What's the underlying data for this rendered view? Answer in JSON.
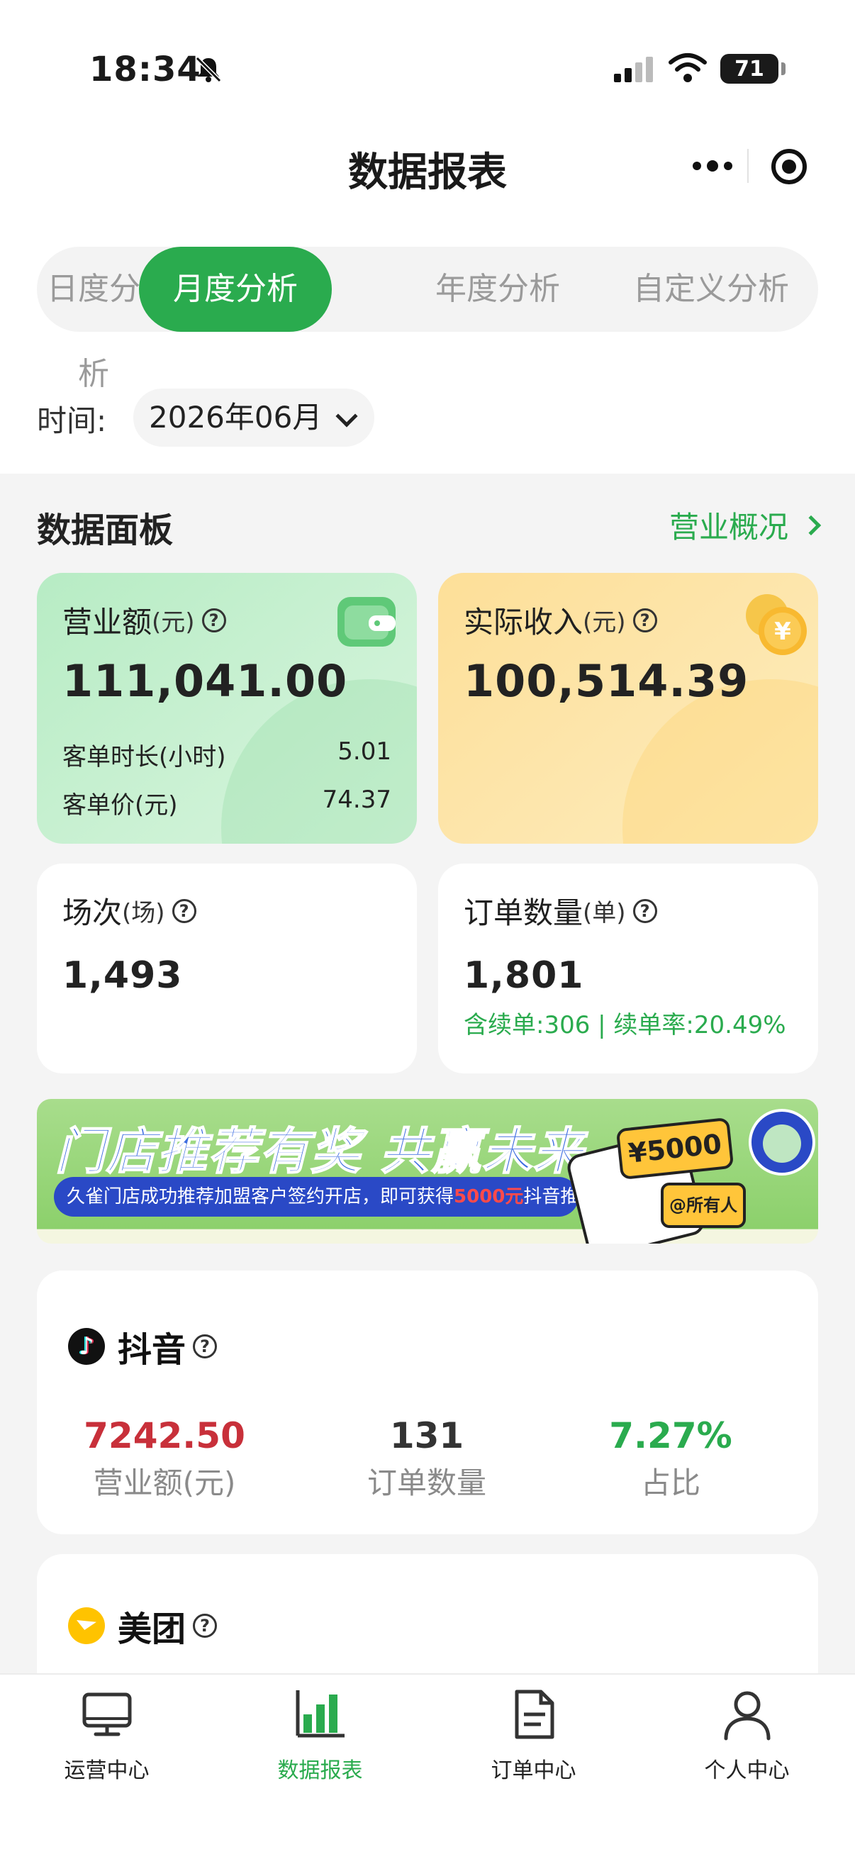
{
  "status_bar": {
    "time": "18:34",
    "battery": "71"
  },
  "nav": {
    "title": "数据报表"
  },
  "tabs": [
    {
      "label": "日度分析",
      "active": false
    },
    {
      "label": "月度分析",
      "active": true
    },
    {
      "label": "年度分析",
      "active": false
    },
    {
      "label": "自定义分析",
      "active": false
    }
  ],
  "time_filter": {
    "label": "时间:",
    "value": "2026年06月"
  },
  "panel": {
    "title": "数据面板",
    "link": "营业概况"
  },
  "cards": {
    "revenue": {
      "label": "营业额",
      "unit": "(元)",
      "value": "111,041.00",
      "rows": [
        {
          "label": "客单时长(小时)",
          "value": "5.01"
        },
        {
          "label": "客单价(元)",
          "value": "74.37"
        }
      ]
    },
    "income": {
      "label": "实际收入",
      "unit": "(元)",
      "value": "100,514.39"
    },
    "sessions": {
      "label": "场次",
      "unit": "(场)",
      "value": "1,493"
    },
    "orders": {
      "label": "订单数量",
      "unit": "(单)",
      "value": "1,801",
      "sub": "含续单:306 | 续单率:20.49%"
    }
  },
  "banner": {
    "title": "门店推荐有奖 共赢未来",
    "text_before": "久雀门店成功推荐加盟客户签约开店，即可获得",
    "text_highlight": "5000元",
    "text_after": "抖音推广费!",
    "price_tag": "¥5000",
    "mention_tag": "@所有人"
  },
  "platforms": [
    {
      "name": "抖音",
      "logo": "douyin-logo",
      "stats": [
        {
          "value": "7242.50",
          "label": "营业额(元)",
          "color": "#c8303a"
        },
        {
          "value": "131",
          "label": "订单数量",
          "color": "#333333"
        },
        {
          "value": "7.27%",
          "label": "占比",
          "color": "#2aab4e"
        }
      ]
    },
    {
      "name": "美团",
      "logo": "meituan-logo"
    }
  ],
  "tabbar": [
    {
      "label": "运营中心",
      "icon": "monitor-icon",
      "active": false
    },
    {
      "label": "数据报表",
      "icon": "chart-icon",
      "active": true
    },
    {
      "label": "订单中心",
      "icon": "document-icon",
      "active": false
    },
    {
      "label": "个人中心",
      "icon": "user-icon",
      "active": false
    }
  ],
  "colors": {
    "primary": "#2aab4e",
    "revenue_red": "#c8303a"
  }
}
